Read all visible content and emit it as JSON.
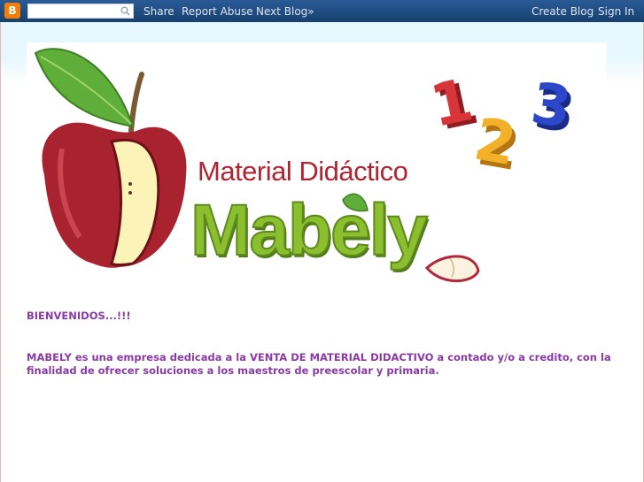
{
  "navbar": {
    "logo_letter": "B",
    "search_placeholder": "",
    "share": "Share",
    "report_abuse": "Report Abuse",
    "next_blog": "Next Blog»",
    "create_blog": "Create Blog",
    "sign_in": "Sign In"
  },
  "header": {
    "tagline": "Material Didáctico",
    "brand": "Mabely",
    "numbers": [
      "1",
      "2",
      "3"
    ]
  },
  "post": {
    "welcome": "BIENVENIDOS...!!!",
    "body": "MABELY es una empresa dedicada a la VENTA DE MATERIAL DIDACTIVO a contado y/o a credito, con la finalidad de ofrecer soluciones a los maestros de preescolar y primaria."
  },
  "colors": {
    "navbar": "#1f4c84",
    "post_text": "#8a3aa5",
    "brand_green": "#8bbf2d",
    "tagline_red": "#b02431"
  }
}
